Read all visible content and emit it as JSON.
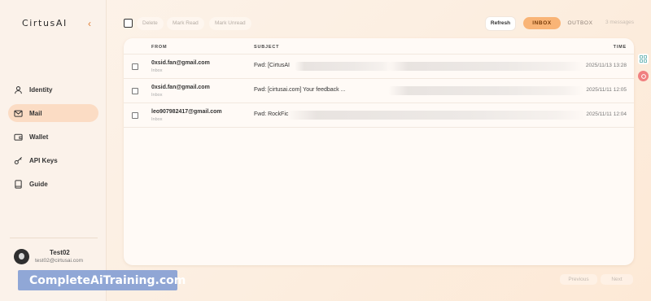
{
  "app": {
    "logo": "CirtusAI"
  },
  "sidebar": {
    "items": [
      {
        "label": "Identity",
        "icon": "user-icon"
      },
      {
        "label": "Mail",
        "icon": "mail-icon",
        "active": true
      },
      {
        "label": "Wallet",
        "icon": "wallet-icon"
      },
      {
        "label": "API Keys",
        "icon": "key-icon"
      },
      {
        "label": "Guide",
        "icon": "book-icon"
      }
    ],
    "user": {
      "name": "Test02",
      "email": "test02@cirtusai.com"
    }
  },
  "toolbar": {
    "delete_label": "Delete",
    "mark_read_label": "Mark Read",
    "mark_unread_label": "Mark Unread",
    "refresh_label": "Refresh",
    "tab_inbox": "INBOX",
    "tab_outbox": "OUTBOX",
    "count": "3 messages"
  },
  "table": {
    "headers": {
      "from": "FROM",
      "subject": "SUBJECT",
      "time": "TIME"
    },
    "rows": [
      {
        "from": "0xsid.fan@gmail.com",
        "folder": "Inbox",
        "subject": "Fwd: [CirtusAI",
        "time": "2025/11/13 13:28"
      },
      {
        "from": "0xsid.fan@gmail.com",
        "folder": "Inbox",
        "subject": "Fwd: [cirtusai.com] Your feedback ...",
        "time": "2025/11/11 12:05"
      },
      {
        "from": "leo907982417@gmail.com",
        "folder": "Inbox",
        "subject": "Fwd: RockFic",
        "time": "2025/11/11 12:04"
      }
    ]
  },
  "pagination": {
    "previous_label": "Previous",
    "next_label": "Next"
  },
  "watermark": {
    "text": "CompleteAiTraining.com"
  },
  "colors": {
    "accent": "#f9b476",
    "active_nav": "#fbdcc4",
    "collapse_arrow": "#e0813a"
  }
}
